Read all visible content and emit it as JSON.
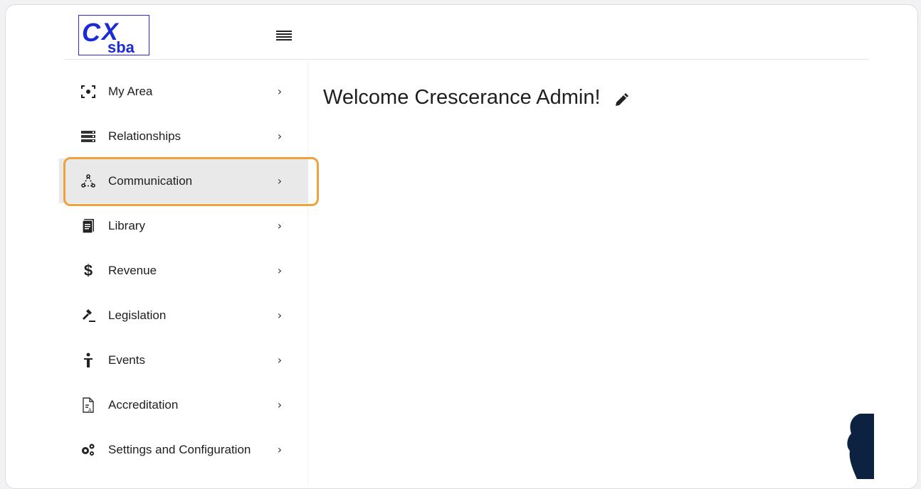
{
  "app": {
    "logo_text": "CXsba"
  },
  "header": {
    "menu_icon": "hamburger-icon"
  },
  "sidebar": {
    "items": [
      {
        "label": "My Area",
        "icon": "focus-dot-icon"
      },
      {
        "label": "Relationships",
        "icon": "list-stack-icon"
      },
      {
        "label": "Communication",
        "icon": "network-triangle-icon",
        "active": true
      },
      {
        "label": "Library",
        "icon": "document-icon"
      },
      {
        "label": "Revenue",
        "icon": "dollar-icon"
      },
      {
        "label": "Legislation",
        "icon": "gavel-icon"
      },
      {
        "label": "Events",
        "icon": "person-podium-icon"
      },
      {
        "label": "Accreditation",
        "icon": "doc-badge-icon"
      },
      {
        "label": "Settings and Configuration",
        "icon": "gears-icon"
      }
    ],
    "chevron": "›"
  },
  "main": {
    "welcome_text": "Welcome Crescerance Admin!",
    "edit_icon": "pencil-icon"
  },
  "colors": {
    "accent_highlight": "#f0a23a",
    "logo_blue": "#1a2bd6",
    "active_bg": "#e9e9ea"
  }
}
